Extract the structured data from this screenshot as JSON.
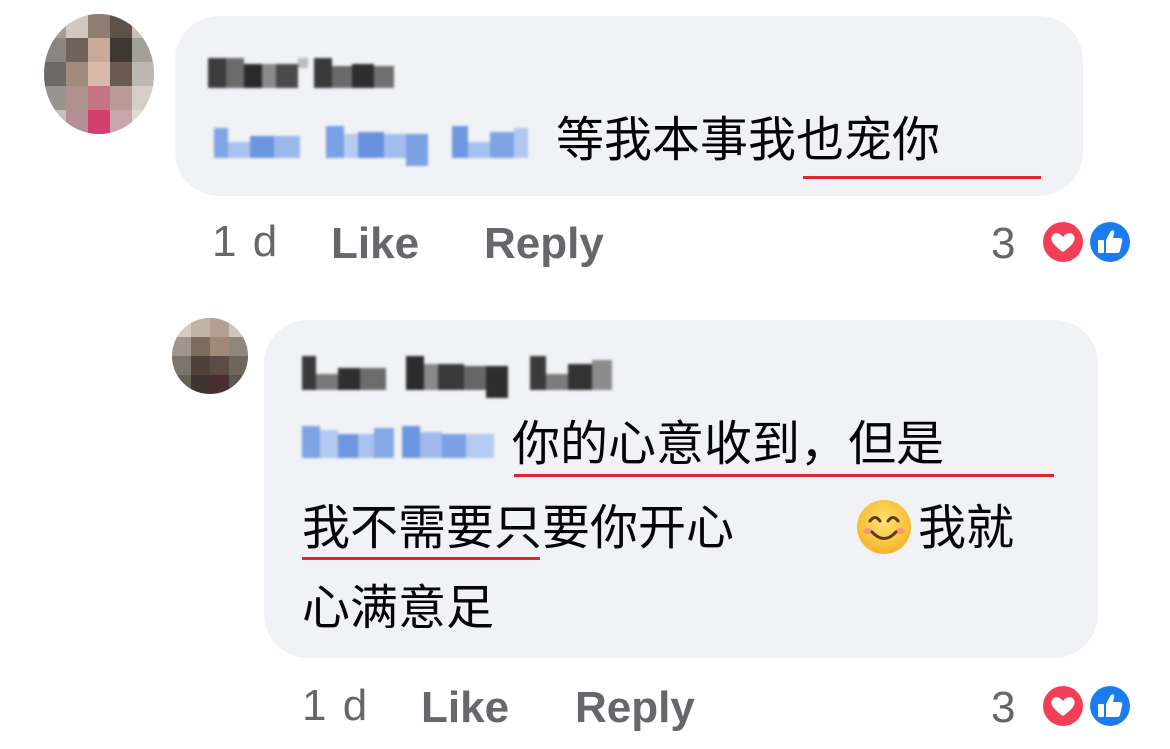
{
  "comments": [
    {
      "author_name_blurred": "Xin Yee",
      "mention_blurred": "Lee Ming Lei",
      "text": "等我本事我也宠你",
      "time": "1 d",
      "like_label": "Like",
      "reply_label": "Reply",
      "reaction_count": "3",
      "reaction_icons": [
        "love-icon",
        "like-icon"
      ]
    },
    {
      "author_name_blurred": "Lee Ming Lei",
      "mention_blurred": "Xin Yee",
      "text_line1": "你的心意收到，但是",
      "text_line2a": "我不需要只要你开心",
      "emoji": "smiling-face-emoji",
      "text_line2b": "我就",
      "text_line3": "心满意足",
      "time": "1 d",
      "like_label": "Like",
      "reply_label": "Reply",
      "reaction_count": "3",
      "reaction_icons": [
        "love-icon",
        "like-icon"
      ]
    }
  ],
  "colors": {
    "bubble": "#f0f2f5",
    "text": "#050505",
    "secondary": "#65676b",
    "mention": "#1877f2",
    "underline": "#e0262f",
    "love": "#f33e58",
    "like": "#1877f2"
  }
}
